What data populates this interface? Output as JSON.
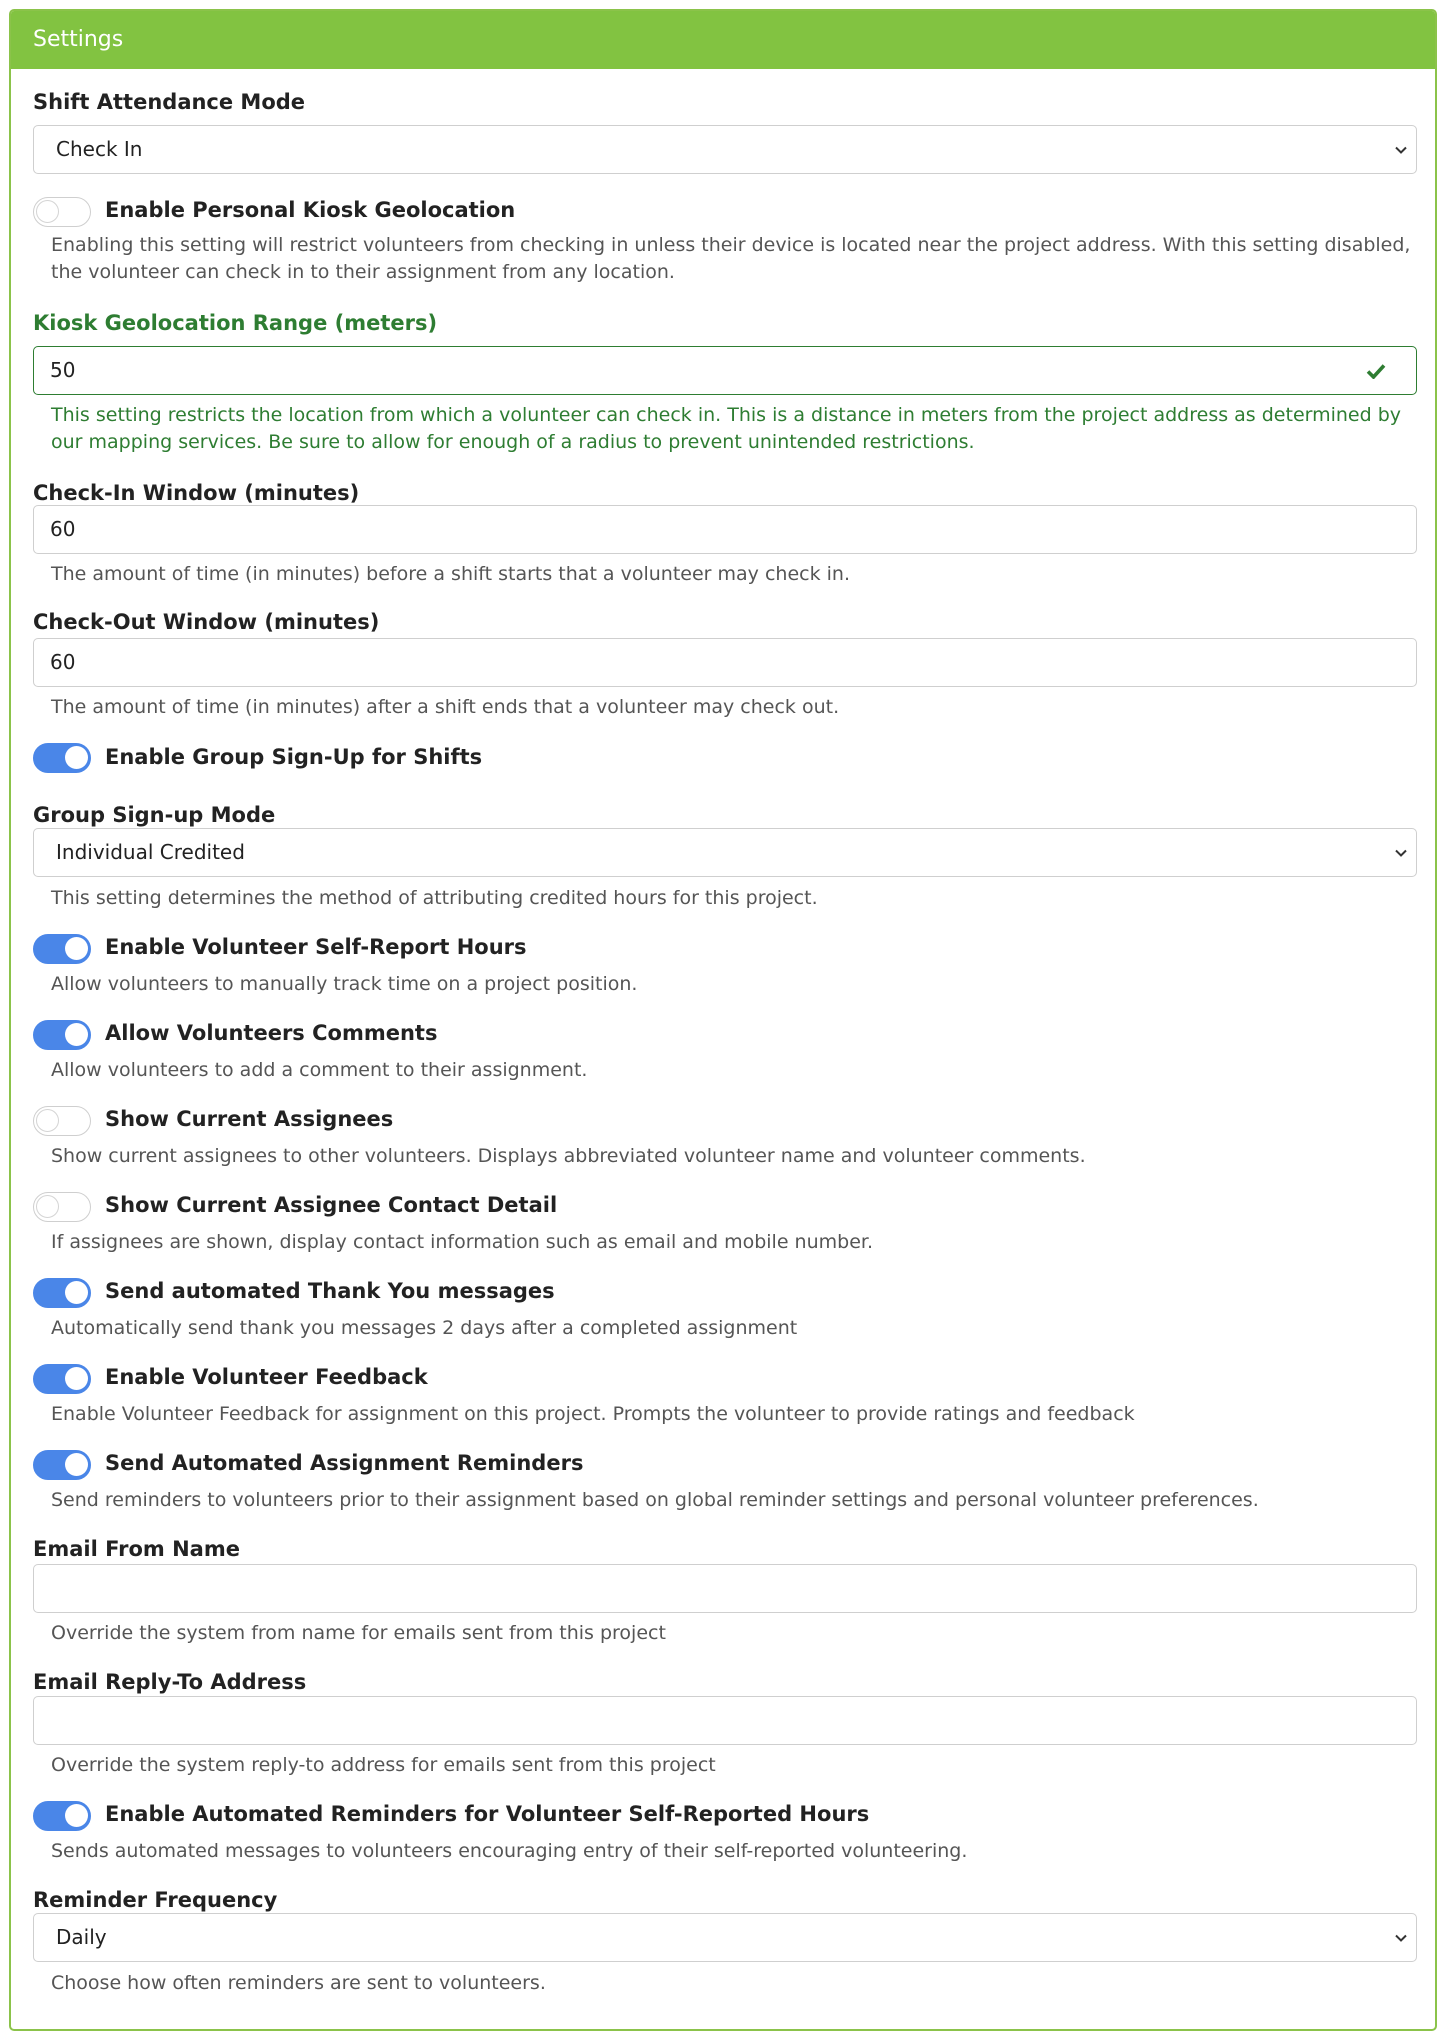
{
  "header": {
    "title": "Settings"
  },
  "colors": {
    "header_green": "#82c341",
    "valid_green": "#2e7d32",
    "toggle_on": "#4a86e8"
  },
  "attendance_mode": {
    "label": "Shift Attendance Mode",
    "value": "Check In"
  },
  "kiosk_geo": {
    "label": "Enable Personal Kiosk Geolocation",
    "enabled": false,
    "help": "Enabling this setting will restrict volunteers from checking in unless their device is located near the project address. With this setting disabled, the volunteer can check in to their assignment from any location."
  },
  "geo_range": {
    "label": "Kiosk Geolocation Range (meters)",
    "value": "50",
    "help": "This setting restricts the location from which a volunteer can check in. This is a distance in meters from the project address as determined by our mapping services. Be sure to allow for enough of a radius to prevent unintended restrictions."
  },
  "checkin_window": {
    "label": "Check-In Window (minutes)",
    "value": "60",
    "help": "The amount of time (in minutes) before a shift starts that a volunteer may check in."
  },
  "checkout_window": {
    "label": "Check-Out Window (minutes)",
    "value": "60",
    "help": "The amount of time (in minutes) after a shift ends that a volunteer may check out."
  },
  "group_signup": {
    "label": "Enable Group Sign-Up for Shifts",
    "enabled": true
  },
  "group_mode": {
    "label": "Group Sign-up Mode",
    "value": "Individual Credited",
    "help": "This setting determines the method of attributing credited hours for this project."
  },
  "self_report": {
    "label": "Enable Volunteer Self-Report Hours",
    "enabled": true,
    "help": "Allow volunteers to manually track time on a project position."
  },
  "comments": {
    "label": "Allow Volunteers Comments",
    "enabled": true,
    "help": "Allow volunteers to add a comment to their assignment."
  },
  "show_assignees": {
    "label": "Show Current Assignees",
    "enabled": false,
    "help": "Show current assignees to other volunteers. Displays abbreviated volunteer name and volunteer comments."
  },
  "assignee_contact": {
    "label": "Show Current Assignee Contact Detail",
    "enabled": false,
    "help": "If assignees are shown, display contact information such as email and mobile number."
  },
  "thank_you": {
    "label": "Send automated Thank You messages",
    "enabled": true,
    "help": "Automatically send thank you messages 2 days after a completed assignment"
  },
  "feedback": {
    "label": "Enable Volunteer Feedback",
    "enabled": true,
    "help": "Enable Volunteer Feedback for assignment on this project. Prompts the volunteer to provide ratings and feedback"
  },
  "assignment_reminders": {
    "label": "Send Automated Assignment Reminders",
    "enabled": true,
    "help": "Send reminders to volunteers prior to their assignment based on global reminder settings and personal volunteer preferences."
  },
  "email_from": {
    "label": "Email From Name",
    "value": "",
    "help": "Override the system from name for emails sent from this project"
  },
  "reply_to": {
    "label": "Email Reply-To Address",
    "value": "",
    "help": "Override the system reply-to address for emails sent from this project"
  },
  "self_report_reminders": {
    "label": "Enable Automated Reminders for Volunteer Self-Reported Hours",
    "enabled": true,
    "help": "Sends automated messages to volunteers encouraging entry of their self-reported volunteering."
  },
  "reminder_frequency": {
    "label": "Reminder Frequency",
    "value": "Daily",
    "help": "Choose how often reminders are sent to volunteers."
  }
}
